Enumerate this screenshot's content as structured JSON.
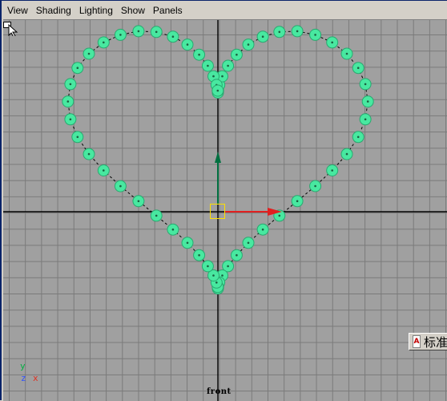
{
  "menubar": {
    "items": [
      "View",
      "Shading",
      "Lighting",
      "Show",
      "Panels"
    ]
  },
  "viewport": {
    "camera_label": "front",
    "axis_indicator": {
      "y": "y",
      "z": "z",
      "x": "x"
    }
  },
  "ime": {
    "icon": "ime-language-icon",
    "text": "标准"
  },
  "colors": {
    "grid_background": "#a0a0a0",
    "grid_lines": "#7a7a7a",
    "cv_points": "#48e8a0",
    "x_axis_manip": "#e02020",
    "y_axis_manip": "#007040",
    "origin_box": "#ffe000"
  }
}
